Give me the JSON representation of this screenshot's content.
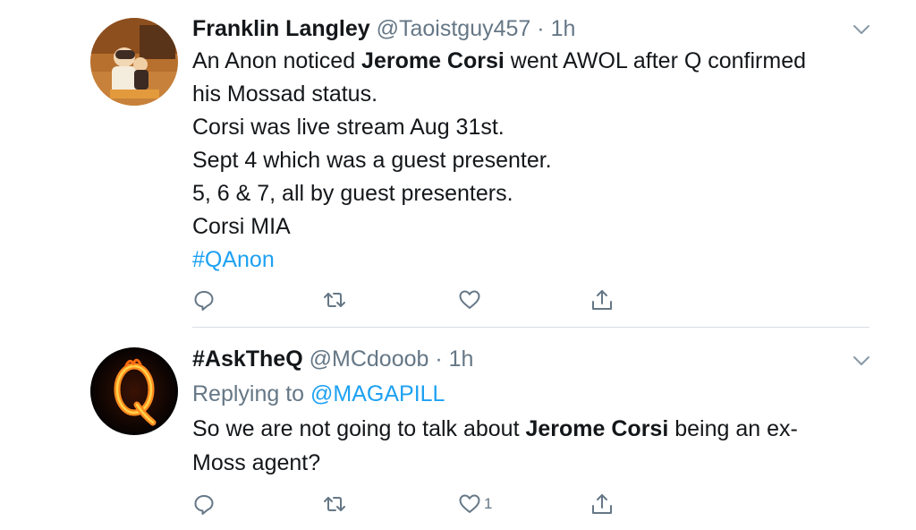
{
  "tweets": [
    {
      "author_name": "Franklin Langley",
      "handle": "@Taoistguy457",
      "separator": "·",
      "time": "1h",
      "lines": [
        {
          "pre": "An Anon noticed ",
          "bold": "Jerome Corsi",
          "post": " went AWOL after Q confirmed"
        },
        {
          "text": "his Mossad status."
        },
        {
          "text": "Corsi was live stream Aug 31st."
        },
        {
          "text": "Sept 4 which was a guest presenter."
        },
        {
          "text": "5, 6 & 7, all by guest presenters."
        },
        {
          "text": "Corsi MIA"
        }
      ],
      "hashtag": "#QAnon",
      "like_count": ""
    },
    {
      "author_name": "#AskTheQ",
      "handle": "@MCdooob",
      "separator": "·",
      "time": "1h",
      "replying_prefix": "Replying to ",
      "replying_handle": "@MAGAPILL",
      "text_pre": "So we are not going to talk about ",
      "text_bold": "Jerome Corsi",
      "text_post": " being an ex-",
      "text_line2": "Moss agent?",
      "like_count": "1"
    }
  ],
  "icons": {
    "reply": "reply-icon",
    "retweet": "retweet-icon",
    "like": "heart-icon",
    "share": "share-icon",
    "menu": "chevron-down-icon"
  },
  "colors": {
    "text": "#14171a",
    "secondary": "#657786",
    "link": "#1da1f2",
    "divider": "#d8dee3"
  }
}
